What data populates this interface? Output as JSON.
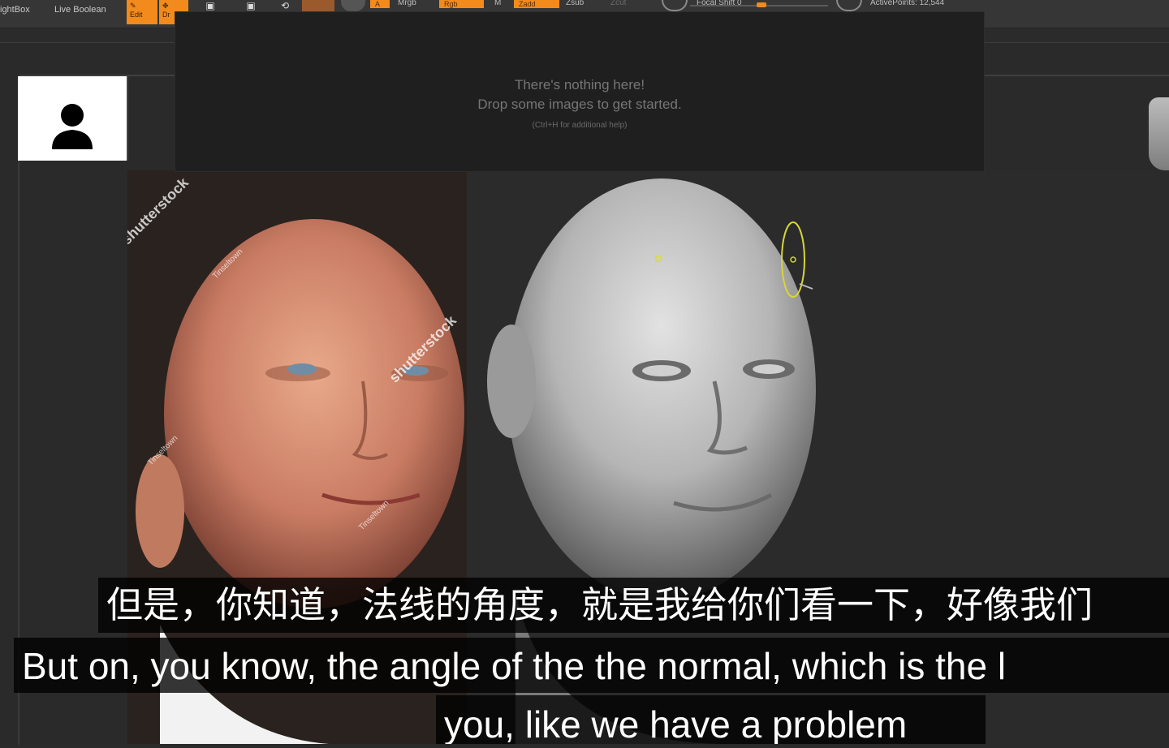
{
  "toolbar": {
    "lightbox_label": "ightBox",
    "live_boolean_label": "Live Boolean",
    "edit_label": "Edit",
    "draw_label": "Dr",
    "mrgb_label": "Mrgb",
    "rgb_label": "Rgb",
    "m_label": "M",
    "zadd_label": "Zadd",
    "zsub_label": "Zsub",
    "focal_shift_label": "Focal Shift 0",
    "active_points_label": "ActivePoints: 12,544",
    "accent_color": "#f28a1c"
  },
  "lightbox_popup": {
    "title": "There's nothing here!",
    "subtitle": "Drop some images to get started.",
    "hint": "(Ctrl+H for additional help)"
  },
  "reference_image": {
    "watermark_main": "shutterstock",
    "watermark_credit": "Tinseltown"
  },
  "subtitles": {
    "chinese": "但是，你知道，法线的角度，就是我给你们看一下，好像我们",
    "english_line1": "But on, you know, the angle of the the normal, which is the l",
    "english_line2": "you, like we have a problem"
  }
}
